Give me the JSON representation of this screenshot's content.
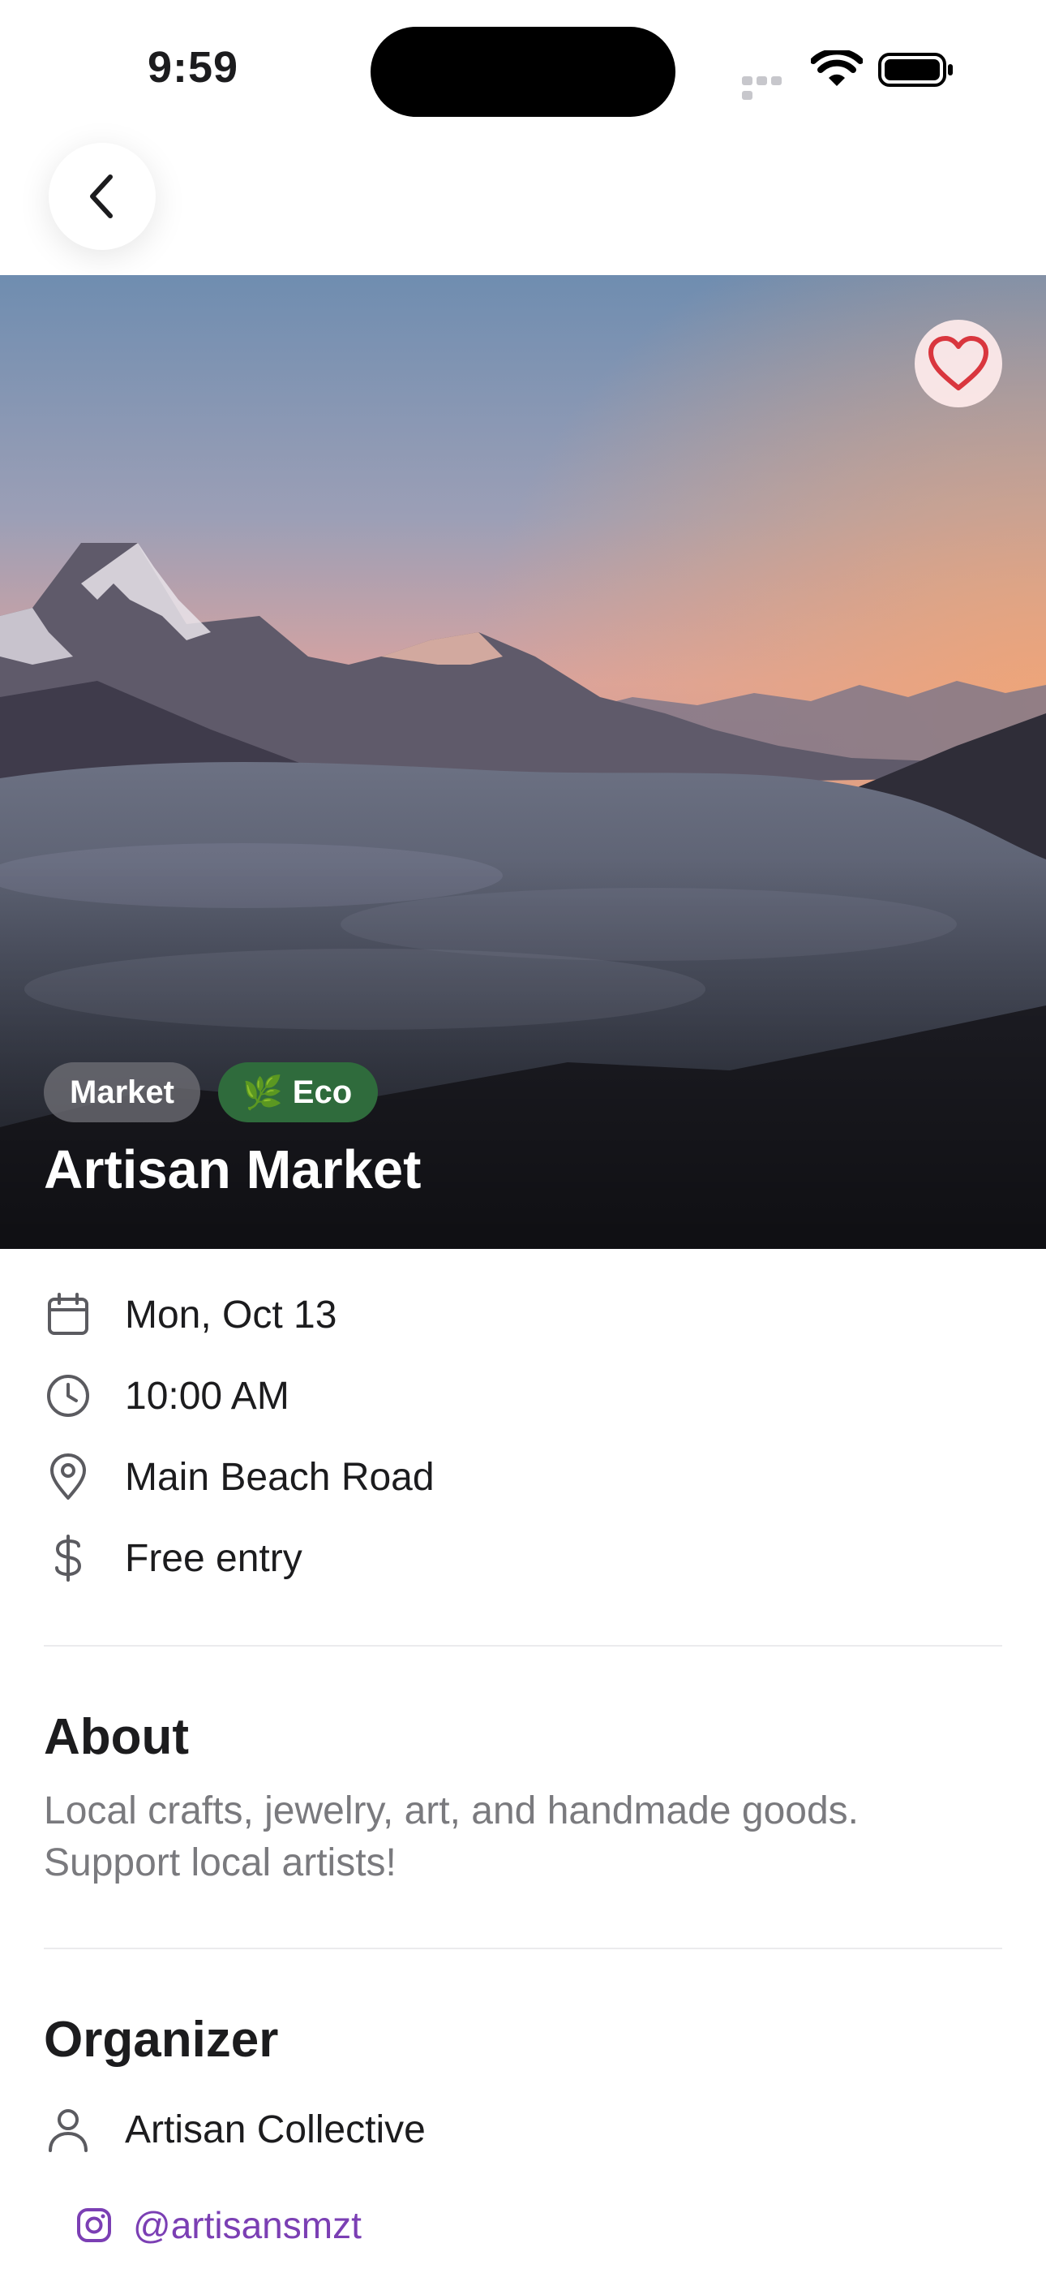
{
  "status_bar": {
    "time": "9:59"
  },
  "event": {
    "tags": [
      {
        "label": "Market",
        "icon": ""
      },
      {
        "label": "Eco",
        "icon": "🌿"
      }
    ],
    "title": "Artisan Market",
    "details": {
      "date": "Mon, Oct 13",
      "time": "10:00 AM",
      "location": "Main Beach Road",
      "price": "Free entry"
    }
  },
  "about": {
    "heading": "About",
    "text": "Local crafts, jewelry, art, and handmade goods. Support local artists!"
  },
  "organizer": {
    "heading": "Organizer",
    "name": "Artisan Collective",
    "instagram": "@artisansmzt"
  },
  "colors": {
    "accent_purple": "#7b3fb4",
    "eco_green": "#2f6b3c",
    "heart_red": "#d9363e"
  },
  "icons": {
    "back": "chevron-left-icon",
    "favorite": "heart-icon",
    "date": "calendar-icon",
    "time": "clock-icon",
    "location": "map-pin-icon",
    "price": "dollar-icon",
    "organizer": "person-icon",
    "social": "instagram-icon"
  }
}
